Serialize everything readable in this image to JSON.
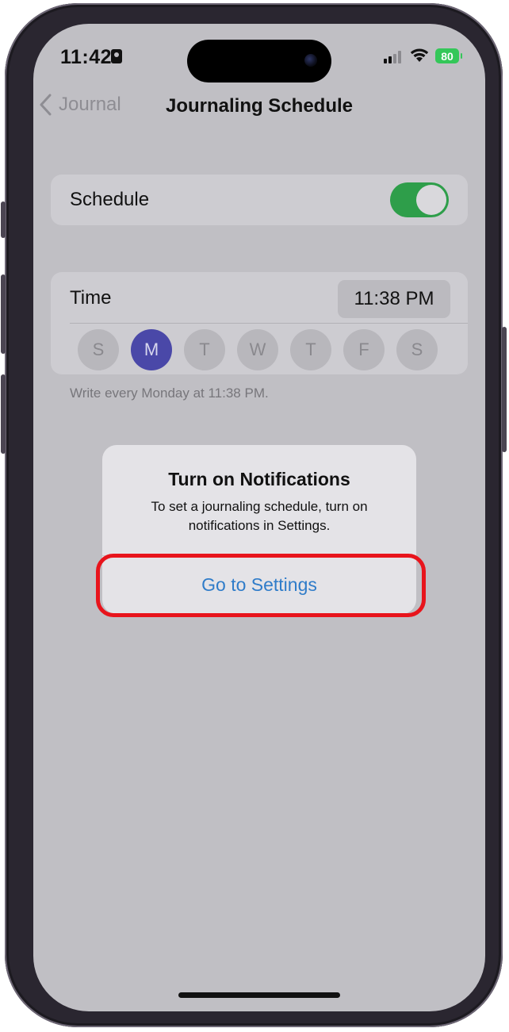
{
  "status_bar": {
    "time": "11:42",
    "battery": "80"
  },
  "nav": {
    "back_label": "Journal",
    "title": "Journaling Schedule"
  },
  "schedule": {
    "label": "Schedule",
    "enabled": true
  },
  "time_row": {
    "label": "Time",
    "value": "11:38 PM"
  },
  "days": [
    {
      "letter": "S",
      "selected": false
    },
    {
      "letter": "M",
      "selected": true
    },
    {
      "letter": "T",
      "selected": false
    },
    {
      "letter": "W",
      "selected": false
    },
    {
      "letter": "T",
      "selected": false
    },
    {
      "letter": "F",
      "selected": false
    },
    {
      "letter": "S",
      "selected": false
    }
  ],
  "footnote": "Write every Monday at 11:38 PM.",
  "alert": {
    "title": "Turn on Notifications",
    "message": "To set a journaling schedule, turn on notifications in Settings.",
    "button": "Go to Settings"
  },
  "colors": {
    "accent": "#4a48a8",
    "toggle_on": "#2e9e4a",
    "link": "#2f7cc9",
    "highlight": "#e8141c",
    "battery": "#34c759"
  }
}
